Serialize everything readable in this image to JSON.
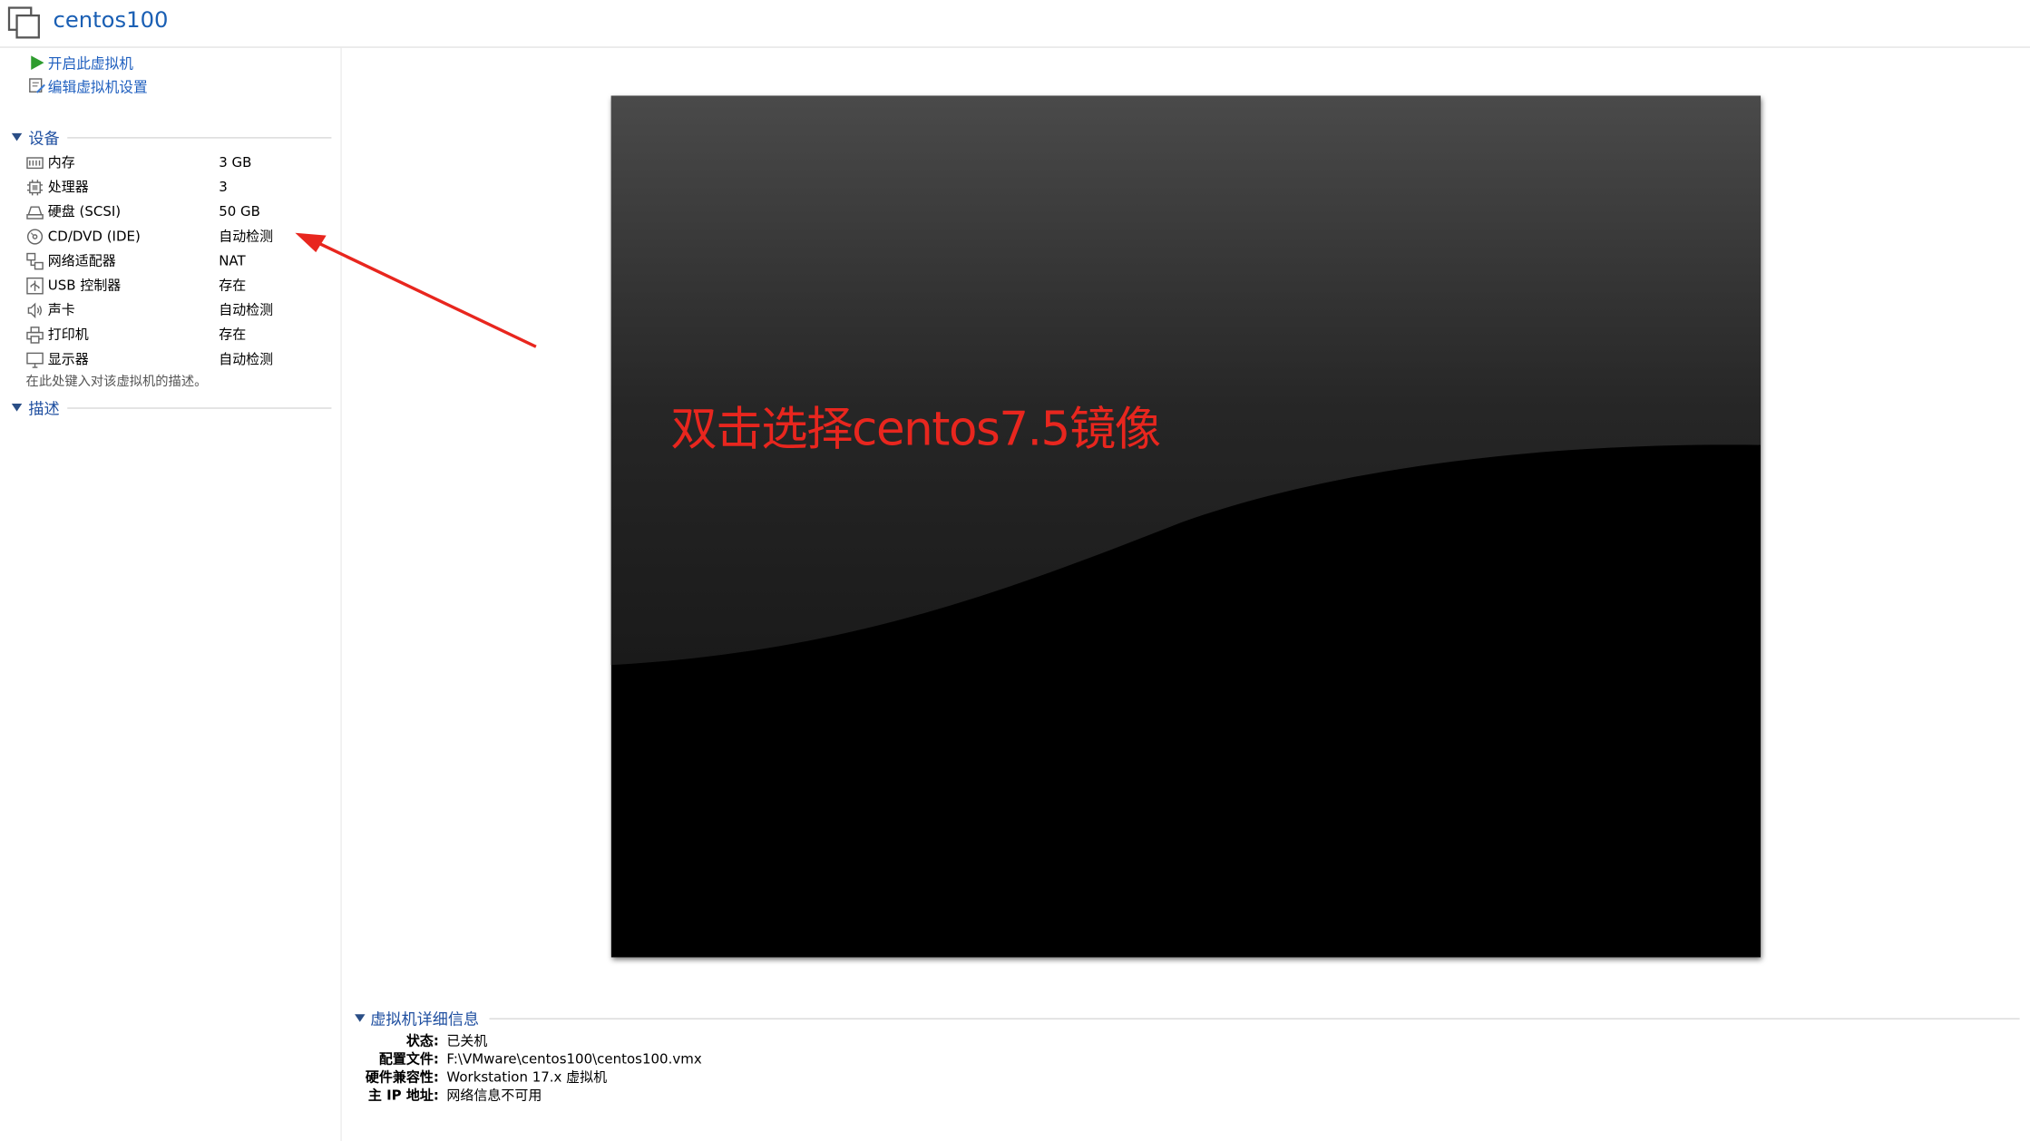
{
  "window": {
    "title": "centos100"
  },
  "actions": [
    {
      "label": "开启此虚拟机",
      "icon": "play-icon"
    },
    {
      "label": "编辑虚拟机设置",
      "icon": "edit-settings-icon"
    }
  ],
  "devices": {
    "header": "设备",
    "items": [
      {
        "name": "内存",
        "value": "3 GB",
        "icon": "memory-icon"
      },
      {
        "name": "处理器",
        "value": "3",
        "icon": "processor-icon"
      },
      {
        "name": "硬盘 (SCSI)",
        "value": "50 GB",
        "icon": "hard-disk-icon"
      },
      {
        "name": "CD/DVD (IDE)",
        "value": "自动检测",
        "icon": "cd-dvd-icon"
      },
      {
        "name": "网络适配器",
        "value": "NAT",
        "icon": "network-adapter-icon"
      },
      {
        "name": "USB 控制器",
        "value": "存在",
        "icon": "usb-controller-icon"
      },
      {
        "name": "声卡",
        "value": "自动检测",
        "icon": "sound-card-icon"
      },
      {
        "name": "打印机",
        "value": "存在",
        "icon": "printer-icon"
      },
      {
        "name": "显示器",
        "value": "自动检测",
        "icon": "display-icon"
      }
    ]
  },
  "description": {
    "header": "描述",
    "placeholder": "在此处键入对该虚拟机的描述。"
  },
  "annotation": {
    "text": "双击选择centos7.5镜像",
    "color": "#e8261e"
  },
  "details": {
    "header": "虚拟机详细信息",
    "rows": [
      {
        "label": "状态:",
        "value": "已关机"
      },
      {
        "label": "配置文件:",
        "value": "F:\\VMware\\centos100\\centos100.vmx"
      },
      {
        "label": "硬件兼容性:",
        "value": "Workstation 17.x 虚拟机"
      },
      {
        "label": "主 IP 地址:",
        "value": "网络信息不可用"
      }
    ]
  },
  "colors": {
    "link": "#1f5fbf",
    "section": "#1f4fa0",
    "title": "#1a5fb4"
  }
}
